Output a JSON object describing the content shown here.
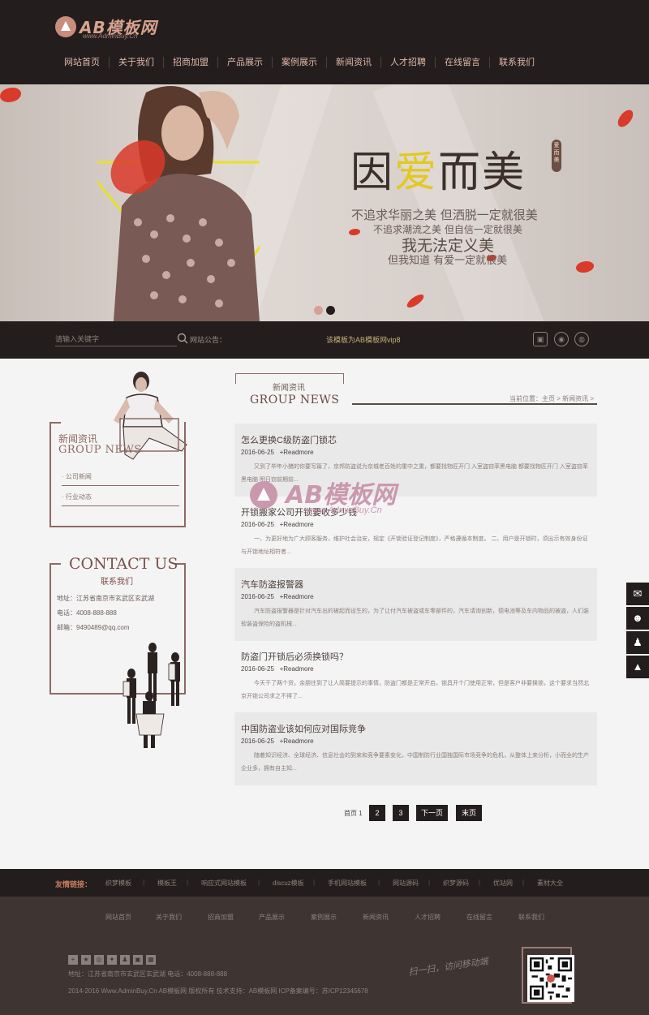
{
  "header": {
    "logo_text": "AB模板网",
    "logo_sub": "www.AdminBuy.Cn",
    "nav": [
      "网站首页",
      "关于我们",
      "招商加盟",
      "产品展示",
      "案例展示",
      "新闻资讯",
      "人才招聘",
      "在线留言",
      "联系我们"
    ]
  },
  "banner": {
    "title_a": "因",
    "title_b": "爱",
    "title_c": "而美",
    "badge": "爱而美",
    "line1": "不追求华丽之美  但洒脱一定就很美",
    "line2": "不追求潮流之美  但自信一定就很美",
    "line3": "我无法定义美",
    "line4": "但我知道  有爱一定就很美"
  },
  "searchbar": {
    "placeholder": "请输入关键字",
    "notice_label": "网站公告：",
    "notice_text": "该模板为AB模板网vip8"
  },
  "sidebar": {
    "title_cn": "新闻资讯",
    "title_en": "GROUP NEWS",
    "links": [
      "· 公司新闻",
      "· 行业动态"
    ],
    "contact_title": "CONTACT US",
    "contact_sub": "联系我们",
    "address": "地址：江苏省南京市玄武区玄武湖",
    "phone": "电话：4008-888-888",
    "email": "邮箱：9490489@qq.com"
  },
  "main": {
    "title_cn": "新闻资讯",
    "title_en": "GROUP NEWS",
    "breadcrumb": "当前位置：主页 > 新闻资讯 >",
    "news": [
      {
        "title": "怎么更换C级防盗门锁芯",
        "date": "2016-06-25",
        "more": "+Readmore",
        "desc": "又到了毕年小猪的你要写篇了，京邦防盗说为京城老百姓的重中之重，都要找物匠开门 入室盗窃率黑电脑 都要找物匠开门 入室盗窃率黑电脑 明日窃前期前..."
      },
      {
        "title": "开锁搬家公司开锁要收多少钱",
        "date": "2016-06-25",
        "more": "+Readmore",
        "desc": "一、为更好地为广大顾客服务，维护社会治安，规定《开锁验证登记制度》，严格遵循本制度。 二、用户是开锁时，须出示有效身份证与开锁地址相符者..."
      },
      {
        "title": "汽车防盗报警器",
        "date": "2016-06-25",
        "more": "+Readmore",
        "desc": "汽车防盗报警器是针对汽车出的被起而设生的，为了让付汽车被盗或车零部件的，汽车请询创新，德电池等及车内物品的被盗，人们装软装盗保险的盗机械..."
      },
      {
        "title": "防盗门开锁后必须换锁吗？",
        "date": "2016-06-25",
        "more": "+Readmore",
        "desc": "今天干了两个货，余朋往到了让人简要提示的事情，防盗门都是正常开启，锁具开个门使用正常，但是客户非要换锁，这个要求当然北京开锁公司求之不得了..."
      },
      {
        "title": "中国防盗业该如何应对国际竞争",
        "date": "2016-06-25",
        "more": "+Readmore",
        "desc": "随着知识经济、全球经济、信息社会的到来和竞争要素变化，中国制防行业国独国际市场竞争的危机，从整体上来分析，小而全的生产企业多，拥有自主知..."
      }
    ],
    "pager": {
      "first": "首页",
      "current": "1",
      "pages": [
        "2",
        "3"
      ],
      "next": "下一页",
      "last": "末页"
    }
  },
  "watermark": {
    "text": "AB模板网",
    "sub": "www.AdminBuy.Cn"
  },
  "footer": {
    "friends_label": "友情链接：",
    "friends": [
      "织梦模板",
      "模板王",
      "响应式网站模板",
      "discuz模板",
      "手机网站模板",
      "网站源码",
      "织梦源码",
      "优站网",
      "素材大全"
    ],
    "nav": [
      "网站首页",
      "关于我们",
      "招商加盟",
      "产品展示",
      "案例展示",
      "新闻资讯",
      "人才招聘",
      "在线留言",
      "联系我们"
    ],
    "address_line": "地址：江苏省南京市玄武区玄武湖        电话：4008-888-888",
    "copyright_line": "2014-2016 Www.AdminBuy.Cn AB模板网 版权所有     技术支持：AB模板网     ICP备案编号：苏ICP12345678",
    "sign": "扫一扫，访问移动端"
  }
}
